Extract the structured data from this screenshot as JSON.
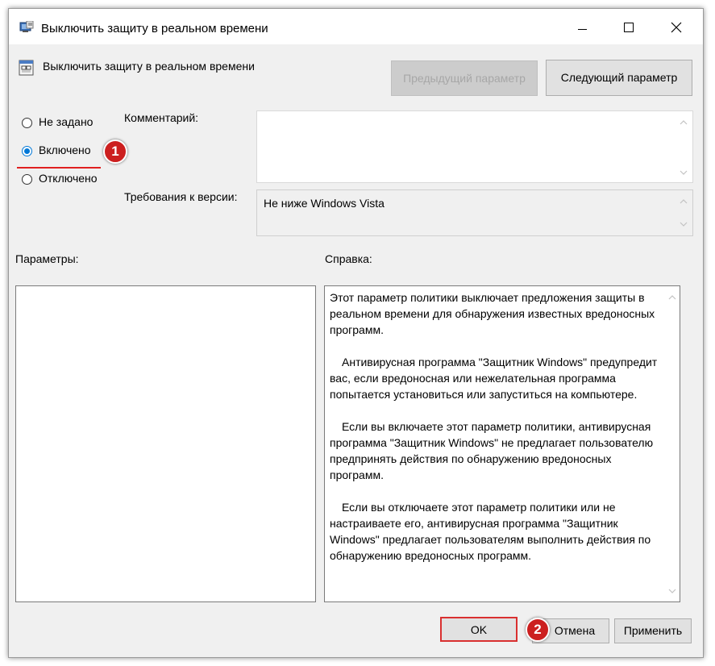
{
  "window": {
    "title": "Выключить защиту в реальном времени",
    "icon": "policy-editor-icon"
  },
  "policy": {
    "title": "Выключить защиту в реальном времени",
    "prev_button": "Предыдущий параметр",
    "next_button": "Следующий параметр"
  },
  "state": {
    "options": [
      "Не задано",
      "Включено",
      "Отключено"
    ],
    "selected": "Включено"
  },
  "comment": {
    "label": "Комментарий:",
    "value": ""
  },
  "version": {
    "label": "Требования к версии:",
    "value": "Не ниже Windows Vista"
  },
  "params": {
    "label": "Параметры:"
  },
  "help": {
    "label": "Справка:",
    "paragraphs": [
      "Этот параметр политики выключает предложения защиты в реальном времени для обнаружения известных вредоносных программ.",
      "Антивирусная программа \"Защитник Windows\" предупредит вас, если вредоносная или нежелательная программа попытается установиться или запуститься на компьютере.",
      "Если вы включаете этот параметр политики, антивирусная программа \"Защитник Windows\" не предлагает пользователю предпринять действия по обнаружению вредоносных программ.",
      "Если вы отключаете этот параметр политики или не настраиваете его, антивирусная программа \"Защитник Windows\" предлагает пользователям выполнить действия по обнаружению вредоносных программ."
    ]
  },
  "footer": {
    "ok": "OK",
    "cancel": "Отмена",
    "apply": "Применить"
  },
  "annotations": {
    "badge1": "1",
    "badge2": "2",
    "highlight_color": "#d93030"
  }
}
